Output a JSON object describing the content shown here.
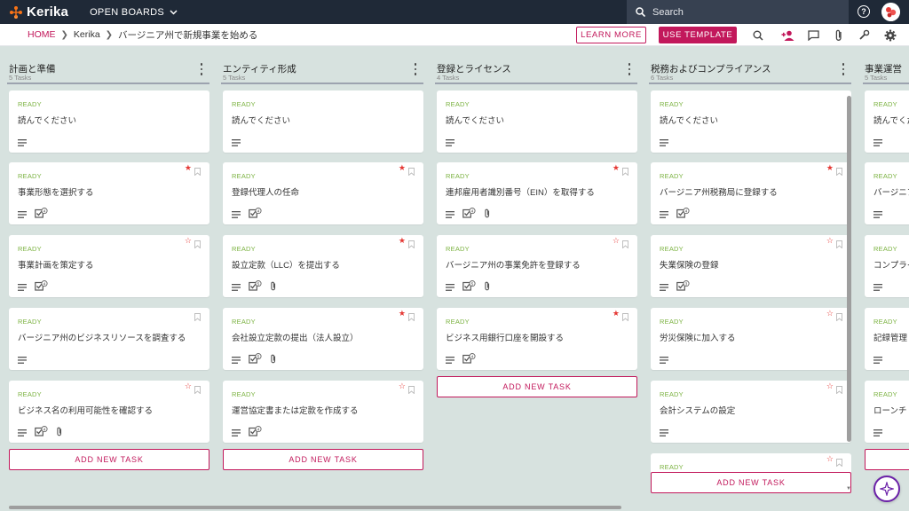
{
  "app": {
    "name": "Kerika",
    "open_boards": "OPEN BOARDS"
  },
  "search": {
    "placeholder": "Search"
  },
  "topbar": {
    "help_icon": "question-circle-icon"
  },
  "breadcrumb": {
    "home": "HOME",
    "org": "Kerika",
    "board": "バージニア州で新規事業を始める"
  },
  "actions": {
    "learn_more": "LEARN MORE",
    "use_template": "USE TEMPLATE"
  },
  "toolbar_icons": [
    "search-icon",
    "add-person-icon",
    "chat-icon",
    "attachment-icon",
    "wrench-icon",
    "gear-icon"
  ],
  "colors": {
    "accent": "#c2185b",
    "ready": "#7cb342",
    "topbar": "#1f2937",
    "board_bg": "#d7e2df"
  },
  "add_task_label": "ADD NEW TASK",
  "columns": [
    {
      "title": "計画と準備",
      "count": "5 Tasks",
      "cards": [
        {
          "status": "READY",
          "title": "読んでください",
          "star": "none",
          "checklist": "",
          "attach": false
        },
        {
          "status": "READY",
          "title": "事業形態を選択する",
          "star": "filled",
          "checklist": "4",
          "attach": false
        },
        {
          "status": "READY",
          "title": "事業計画を策定する",
          "star": "empty",
          "checklist": "4",
          "attach": false
        },
        {
          "status": "READY",
          "title": "バージニア州のビジネスリソースを調査する",
          "star": "none",
          "checklist": "",
          "attach": false
        },
        {
          "status": "READY",
          "title": "ビジネス名の利用可能性を確認する",
          "star": "empty",
          "checklist": "4",
          "attach": true
        }
      ]
    },
    {
      "title": "エンティティ形成",
      "count": "5 Tasks",
      "cards": [
        {
          "status": "READY",
          "title": "読んでください",
          "star": "none",
          "checklist": "",
          "attach": false
        },
        {
          "status": "READY",
          "title": "登録代理人の任命",
          "star": "filled",
          "checklist": "4",
          "attach": false
        },
        {
          "status": "READY",
          "title": "設立定款（LLC）を提出する",
          "star": "filled",
          "checklist": "5",
          "attach": true
        },
        {
          "status": "READY",
          "title": "会社設立定款の提出（法人設立）",
          "star": "filled",
          "checklist": "5",
          "attach": true
        },
        {
          "status": "READY",
          "title": "運営協定書または定款を作成する",
          "star": "empty",
          "checklist": "4",
          "attach": false
        }
      ]
    },
    {
      "title": "登録とライセンス",
      "count": "4 Tasks",
      "cards": [
        {
          "status": "READY",
          "title": "読んでください",
          "star": "none",
          "checklist": "",
          "attach": false
        },
        {
          "status": "READY",
          "title": "連邦雇用者識別番号（EIN）を取得する",
          "star": "filled",
          "checklist": "4",
          "attach": true
        },
        {
          "status": "READY",
          "title": "バージニア州の事業免許を登録する",
          "star": "empty",
          "checklist": "5",
          "attach": true
        },
        {
          "status": "READY",
          "title": "ビジネス用銀行口座を開設する",
          "star": "filled",
          "checklist": "4",
          "attach": false
        }
      ]
    },
    {
      "title": "税務およびコンプライアンス",
      "count": "6 Tasks",
      "cards": [
        {
          "status": "READY",
          "title": "読んでください",
          "star": "none",
          "checklist": "",
          "attach": false
        },
        {
          "status": "READY",
          "title": "バージニア州税務局に登録する",
          "star": "filled",
          "checklist": "4",
          "attach": false
        },
        {
          "status": "READY",
          "title": "失業保険の登録",
          "star": "empty",
          "checklist": "3",
          "attach": false
        },
        {
          "status": "READY",
          "title": "労災保険に加入する",
          "star": "empty",
          "checklist": "",
          "attach": false
        },
        {
          "status": "READY",
          "title": "会計システムの設定",
          "star": "empty",
          "checklist": "",
          "attach": false
        },
        {
          "status": "READY",
          "title": "",
          "star": "empty",
          "checklist": "",
          "attach": false
        }
      ]
    },
    {
      "title": "事業運営",
      "count": "5 Tasks",
      "cards": [
        {
          "status": "READY",
          "title": "読んでください",
          "star": "none",
          "checklist": "",
          "attach": false
        },
        {
          "status": "READY",
          "title": "バージニア",
          "star": "none",
          "checklist": "",
          "attach": false
        },
        {
          "status": "READY",
          "title": "コンプライ",
          "star": "none",
          "checklist": "",
          "attach": false
        },
        {
          "status": "READY",
          "title": "記録管理",
          "star": "none",
          "checklist": "",
          "attach": false
        },
        {
          "status": "READY",
          "title": "ローンチ",
          "star": "none",
          "checklist": "",
          "attach": false
        }
      ]
    }
  ]
}
